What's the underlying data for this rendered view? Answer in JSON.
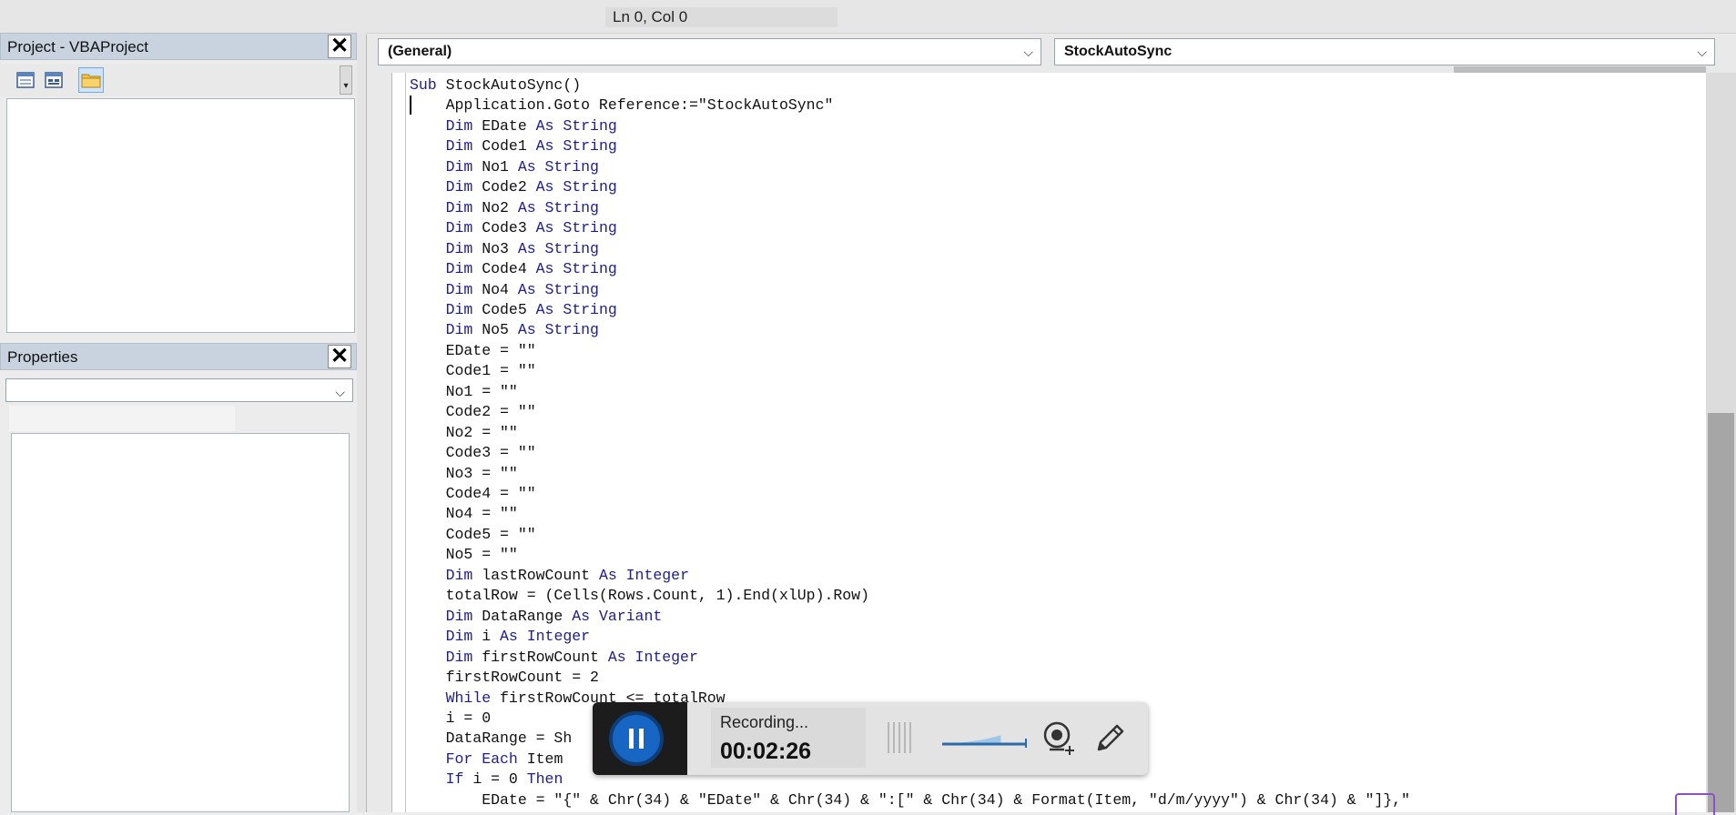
{
  "status_bar": {
    "position": "Ln 0, Col 0"
  },
  "project_pane": {
    "title": "Project - VBAProject",
    "close_glyph": "✕",
    "toolbar": [
      {
        "name": "view-code-icon"
      },
      {
        "name": "view-object-icon"
      },
      {
        "name": "toggle-folders-icon"
      }
    ],
    "scroll_glyph": "▾"
  },
  "properties_pane": {
    "title": "Properties",
    "close_glyph": "✕",
    "object_combo_value": "",
    "chevron": "⌵"
  },
  "code_window": {
    "object_combo": "(General)",
    "procedure_combo": "StockAutoSync",
    "chevron": "⌵",
    "lines": [
      [
        [
          "kw",
          "Sub "
        ],
        [
          "tx",
          "StockAutoSync()"
        ]
      ],
      [
        [
          "tx",
          "    Application.Goto Reference:=\"StockAutoSync\""
        ]
      ],
      [
        [
          "kw",
          "    Dim "
        ],
        [
          "tx",
          "EDate "
        ],
        [
          "kw",
          "As String"
        ]
      ],
      [
        [
          "kw",
          "    Dim "
        ],
        [
          "tx",
          "Code1 "
        ],
        [
          "kw",
          "As String"
        ]
      ],
      [
        [
          "kw",
          "    Dim "
        ],
        [
          "tx",
          "No1 "
        ],
        [
          "kw",
          "As String"
        ]
      ],
      [
        [
          "kw",
          "    Dim "
        ],
        [
          "tx",
          "Code2 "
        ],
        [
          "kw",
          "As String"
        ]
      ],
      [
        [
          "kw",
          "    Dim "
        ],
        [
          "tx",
          "No2 "
        ],
        [
          "kw",
          "As String"
        ]
      ],
      [
        [
          "kw",
          "    Dim "
        ],
        [
          "tx",
          "Code3 "
        ],
        [
          "kw",
          "As String"
        ]
      ],
      [
        [
          "kw",
          "    Dim "
        ],
        [
          "tx",
          "No3 "
        ],
        [
          "kw",
          "As String"
        ]
      ],
      [
        [
          "kw",
          "    Dim "
        ],
        [
          "tx",
          "Code4 "
        ],
        [
          "kw",
          "As String"
        ]
      ],
      [
        [
          "kw",
          "    Dim "
        ],
        [
          "tx",
          "No4 "
        ],
        [
          "kw",
          "As String"
        ]
      ],
      [
        [
          "kw",
          "    Dim "
        ],
        [
          "tx",
          "Code5 "
        ],
        [
          "kw",
          "As String"
        ]
      ],
      [
        [
          "kw",
          "    Dim "
        ],
        [
          "tx",
          "No5 "
        ],
        [
          "kw",
          "As String"
        ]
      ],
      [
        [
          "tx",
          "    EDate = \"\""
        ]
      ],
      [
        [
          "tx",
          "    Code1 = \"\""
        ]
      ],
      [
        [
          "tx",
          "    No1 = \"\""
        ]
      ],
      [
        [
          "tx",
          "    Code2 = \"\""
        ]
      ],
      [
        [
          "tx",
          "    No2 = \"\""
        ]
      ],
      [
        [
          "tx",
          "    Code3 = \"\""
        ]
      ],
      [
        [
          "tx",
          "    No3 = \"\""
        ]
      ],
      [
        [
          "tx",
          "    Code4 = \"\""
        ]
      ],
      [
        [
          "tx",
          "    No4 = \"\""
        ]
      ],
      [
        [
          "tx",
          "    Code5 = \"\""
        ]
      ],
      [
        [
          "tx",
          "    No5 = \"\""
        ]
      ],
      [
        [
          "kw",
          "    Dim "
        ],
        [
          "tx",
          "lastRowCount "
        ],
        [
          "kw",
          "As Integer"
        ]
      ],
      [
        [
          "tx",
          "    totalRow = (Cells(Rows.Count, 1).End(xlUp).Row)"
        ]
      ],
      [
        [
          "kw",
          "    Dim "
        ],
        [
          "tx",
          "DataRange "
        ],
        [
          "kw",
          "As Variant"
        ]
      ],
      [
        [
          "kw",
          "    Dim "
        ],
        [
          "tx",
          "i "
        ],
        [
          "kw",
          "As Integer"
        ]
      ],
      [
        [
          "kw",
          "    Dim "
        ],
        [
          "tx",
          "firstRowCount "
        ],
        [
          "kw",
          "As Integer"
        ]
      ],
      [
        [
          "tx",
          "    firstRowCount = 2"
        ]
      ],
      [
        [
          "kw",
          "    While "
        ],
        [
          "tx",
          "firstRowCount <= totalRow"
        ]
      ],
      [
        [
          "tx",
          "    i = 0"
        ]
      ],
      [
        [
          "tx",
          "    DataRange = Sh                                    stRowCount).Value"
        ]
      ],
      [
        [
          "kw",
          "    For Each "
        ],
        [
          "tx",
          "Item"
        ]
      ],
      [
        [
          "kw",
          "    If "
        ],
        [
          "tx",
          "i = 0 "
        ],
        [
          "kw",
          "Then"
        ]
      ],
      [
        [
          "tx",
          "        EDate = \"{\" & Chr(34) & \"EDate\" & Chr(34) & \":[\" & Chr(34) & Format(Item, \"d/m/yyyy\") & Chr(34) & \"]},\""
        ]
      ]
    ]
  },
  "recorder": {
    "status": "Recording...",
    "timer": "00:02:26",
    "volume_level": 0.7
  }
}
